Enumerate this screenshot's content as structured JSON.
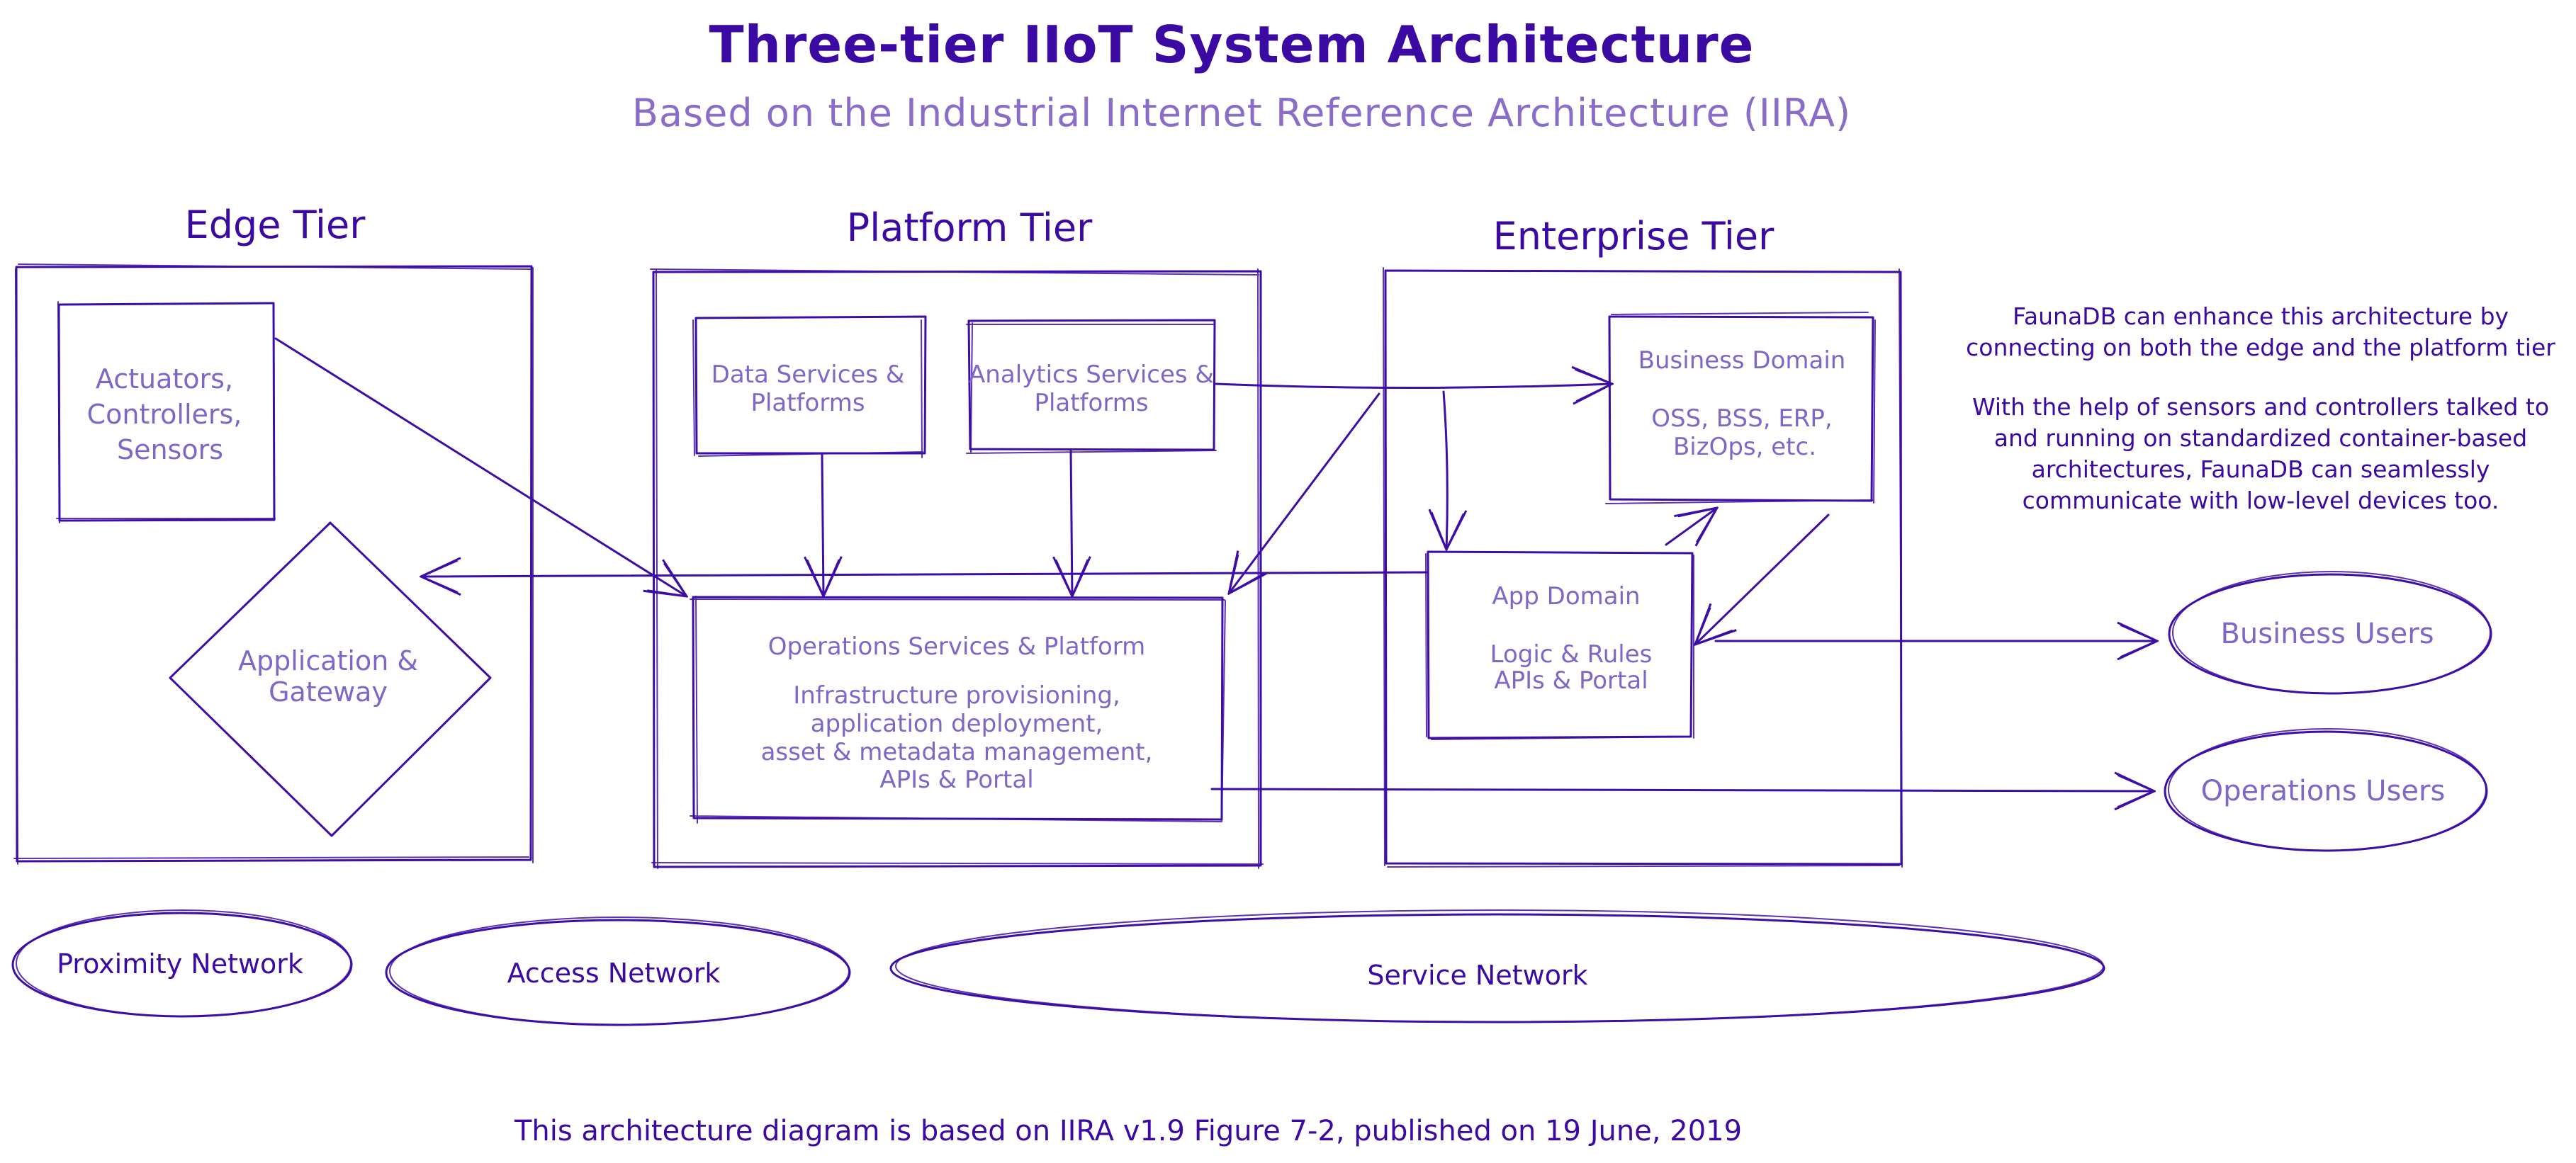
{
  "header": {
    "title": "Three-tier IIoT System Architecture",
    "subtitle": "Based on the Industrial Internet Reference Architecture (IIRA)"
  },
  "tiers": {
    "edge": {
      "label": "Edge Tier",
      "actuators_box": [
        "Actuators,",
        "Controllers,",
        "Sensors"
      ],
      "gateway_diamond": [
        "Application &",
        "Gateway"
      ]
    },
    "platform": {
      "label": "Platform Tier",
      "data_services": [
        "Data Services &",
        "Platforms"
      ],
      "analytics_services": [
        "Analytics Services &",
        "Platforms"
      ],
      "operations": {
        "title": "Operations Services & Platform",
        "lines": [
          "Infrastructure provisioning,",
          "application deployment,",
          "asset & metadata management,",
          "APIs & Portal"
        ]
      }
    },
    "enterprise": {
      "label": "Enterprise Tier",
      "business_domain": {
        "title": "Business Domain",
        "lines": [
          "OSS, BSS, ERP,",
          "BizOps, etc."
        ]
      },
      "app_domain": {
        "title": "App Domain",
        "lines": [
          "Logic & Rules",
          "APIs & Portal"
        ]
      }
    }
  },
  "users": {
    "business": "Business Users",
    "operations": "Operations Users"
  },
  "networks": {
    "proximity": "Proximity Network",
    "access": "Access Network",
    "service": "Service Network"
  },
  "notes": {
    "paragraph1": [
      "FaunaDB can enhance this architecture by",
      "connecting on both the edge and the platform tier"
    ],
    "paragraph2": [
      "With the help of sensors and controllers talked to",
      "and running on standardized container-based",
      "architectures, FaunaDB can seamlessly",
      "communicate with low-level devices too."
    ]
  },
  "footer": "This architecture diagram is based on IIRA v1.9 Figure 7-2, published on 19 June, 2019",
  "colors": {
    "stroke": "#3d0ea6",
    "heading_text": "#3b0aa3",
    "subtitle_text": "#8a6cc9",
    "box_text": "#7f67c6",
    "background": "#ffffff"
  }
}
